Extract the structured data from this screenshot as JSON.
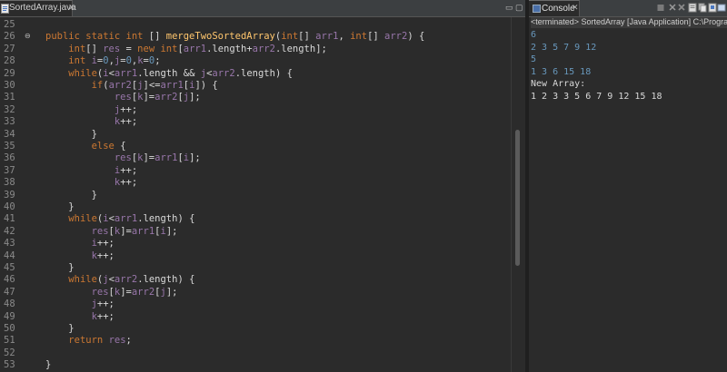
{
  "editor": {
    "tab_label": "SortedArray.java",
    "tab_close": "✕",
    "minimize": "▭",
    "maximize": "▢",
    "lines": [
      {
        "num": "25",
        "tokens": [
          {
            "t": "",
            "c": "pl"
          }
        ]
      },
      {
        "num": "26",
        "fold": true,
        "tokens": [
          {
            "t": "public static int ",
            "c": "kw"
          },
          {
            "t": "[] ",
            "c": "pl"
          },
          {
            "t": "mergeTwoSortedArray",
            "c": "mt"
          },
          {
            "t": "(",
            "c": "pl"
          },
          {
            "t": "int",
            "c": "kw"
          },
          {
            "t": "[] ",
            "c": "pl"
          },
          {
            "t": "arr1",
            "c": "vr"
          },
          {
            "t": ", ",
            "c": "pl"
          },
          {
            "t": "int",
            "c": "kw"
          },
          {
            "t": "[] ",
            "c": "pl"
          },
          {
            "t": "arr2",
            "c": "vr"
          },
          {
            "t": ") {",
            "c": "pl"
          }
        ]
      },
      {
        "num": "27",
        "tokens": [
          {
            "t": "    ",
            "c": "pl"
          },
          {
            "t": "int",
            "c": "kw"
          },
          {
            "t": "[] ",
            "c": "pl"
          },
          {
            "t": "res",
            "c": "vr"
          },
          {
            "t": " = ",
            "c": "pl"
          },
          {
            "t": "new int",
            "c": "kw"
          },
          {
            "t": "[",
            "c": "pl"
          },
          {
            "t": "arr1",
            "c": "vr"
          },
          {
            "t": ".length+",
            "c": "pl"
          },
          {
            "t": "arr2",
            "c": "vr"
          },
          {
            "t": ".length];",
            "c": "pl"
          }
        ]
      },
      {
        "num": "28",
        "tokens": [
          {
            "t": "    ",
            "c": "pl"
          },
          {
            "t": "int ",
            "c": "kw"
          },
          {
            "t": "i",
            "c": "vr"
          },
          {
            "t": "=",
            "c": "pl"
          },
          {
            "t": "0",
            "c": "nm"
          },
          {
            "t": ",",
            "c": "pl"
          },
          {
            "t": "j",
            "c": "vr"
          },
          {
            "t": "=",
            "c": "pl"
          },
          {
            "t": "0",
            "c": "nm"
          },
          {
            "t": ",",
            "c": "pl"
          },
          {
            "t": "k",
            "c": "vr"
          },
          {
            "t": "=",
            "c": "pl"
          },
          {
            "t": "0",
            "c": "nm"
          },
          {
            "t": ";",
            "c": "pl"
          }
        ]
      },
      {
        "num": "29",
        "tokens": [
          {
            "t": "    ",
            "c": "pl"
          },
          {
            "t": "while",
            "c": "kw"
          },
          {
            "t": "(",
            "c": "pl"
          },
          {
            "t": "i",
            "c": "vr"
          },
          {
            "t": "<",
            "c": "pl"
          },
          {
            "t": "arr1",
            "c": "vr"
          },
          {
            "t": ".length && ",
            "c": "pl"
          },
          {
            "t": "j",
            "c": "vr"
          },
          {
            "t": "<",
            "c": "pl"
          },
          {
            "t": "arr2",
            "c": "vr"
          },
          {
            "t": ".length) {",
            "c": "pl"
          }
        ]
      },
      {
        "num": "30",
        "tokens": [
          {
            "t": "        ",
            "c": "pl"
          },
          {
            "t": "if",
            "c": "kw"
          },
          {
            "t": "(",
            "c": "pl"
          },
          {
            "t": "arr2",
            "c": "vr"
          },
          {
            "t": "[",
            "c": "pl"
          },
          {
            "t": "j",
            "c": "vr"
          },
          {
            "t": "]<=",
            "c": "pl"
          },
          {
            "t": "arr1",
            "c": "vr"
          },
          {
            "t": "[",
            "c": "pl"
          },
          {
            "t": "i",
            "c": "vr"
          },
          {
            "t": "]) {",
            "c": "pl"
          }
        ]
      },
      {
        "num": "31",
        "tokens": [
          {
            "t": "            ",
            "c": "pl"
          },
          {
            "t": "res",
            "c": "vr"
          },
          {
            "t": "[",
            "c": "pl"
          },
          {
            "t": "k",
            "c": "vr"
          },
          {
            "t": "]=",
            "c": "pl"
          },
          {
            "t": "arr2",
            "c": "vr"
          },
          {
            "t": "[",
            "c": "pl"
          },
          {
            "t": "j",
            "c": "vr"
          },
          {
            "t": "];",
            "c": "pl"
          }
        ]
      },
      {
        "num": "32",
        "tokens": [
          {
            "t": "            ",
            "c": "pl"
          },
          {
            "t": "j",
            "c": "vr"
          },
          {
            "t": "++;",
            "c": "pl"
          }
        ]
      },
      {
        "num": "33",
        "tokens": [
          {
            "t": "            ",
            "c": "pl"
          },
          {
            "t": "k",
            "c": "vr"
          },
          {
            "t": "++;",
            "c": "pl"
          }
        ]
      },
      {
        "num": "34",
        "tokens": [
          {
            "t": "        }",
            "c": "pl"
          }
        ]
      },
      {
        "num": "35",
        "tokens": [
          {
            "t": "        ",
            "c": "pl"
          },
          {
            "t": "else",
            "c": "kw"
          },
          {
            "t": " {",
            "c": "pl"
          }
        ]
      },
      {
        "num": "36",
        "tokens": [
          {
            "t": "            ",
            "c": "pl"
          },
          {
            "t": "res",
            "c": "vr"
          },
          {
            "t": "[",
            "c": "pl"
          },
          {
            "t": "k",
            "c": "vr"
          },
          {
            "t": "]=",
            "c": "pl"
          },
          {
            "t": "arr1",
            "c": "vr"
          },
          {
            "t": "[",
            "c": "pl"
          },
          {
            "t": "i",
            "c": "vr"
          },
          {
            "t": "];",
            "c": "pl"
          }
        ]
      },
      {
        "num": "37",
        "tokens": [
          {
            "t": "            ",
            "c": "pl"
          },
          {
            "t": "i",
            "c": "vr"
          },
          {
            "t": "++;",
            "c": "pl"
          }
        ]
      },
      {
        "num": "38",
        "tokens": [
          {
            "t": "            ",
            "c": "pl"
          },
          {
            "t": "k",
            "c": "vr"
          },
          {
            "t": "++;",
            "c": "pl"
          }
        ]
      },
      {
        "num": "39",
        "tokens": [
          {
            "t": "        }",
            "c": "pl"
          }
        ]
      },
      {
        "num": "40",
        "tokens": [
          {
            "t": "    }",
            "c": "pl"
          }
        ]
      },
      {
        "num": "41",
        "tokens": [
          {
            "t": "    ",
            "c": "pl"
          },
          {
            "t": "while",
            "c": "kw"
          },
          {
            "t": "(",
            "c": "pl"
          },
          {
            "t": "i",
            "c": "vr"
          },
          {
            "t": "<",
            "c": "pl"
          },
          {
            "t": "arr1",
            "c": "vr"
          },
          {
            "t": ".length) {",
            "c": "pl"
          }
        ]
      },
      {
        "num": "42",
        "tokens": [
          {
            "t": "        ",
            "c": "pl"
          },
          {
            "t": "res",
            "c": "vr"
          },
          {
            "t": "[",
            "c": "pl"
          },
          {
            "t": "k",
            "c": "vr"
          },
          {
            "t": "]=",
            "c": "pl"
          },
          {
            "t": "arr1",
            "c": "vr"
          },
          {
            "t": "[",
            "c": "pl"
          },
          {
            "t": "i",
            "c": "vr"
          },
          {
            "t": "];",
            "c": "pl"
          }
        ]
      },
      {
        "num": "43",
        "tokens": [
          {
            "t": "        ",
            "c": "pl"
          },
          {
            "t": "i",
            "c": "vr"
          },
          {
            "t": "++;",
            "c": "pl"
          }
        ]
      },
      {
        "num": "44",
        "tokens": [
          {
            "t": "        ",
            "c": "pl"
          },
          {
            "t": "k",
            "c": "vr"
          },
          {
            "t": "++;",
            "c": "pl"
          }
        ]
      },
      {
        "num": "45",
        "tokens": [
          {
            "t": "    }",
            "c": "pl"
          }
        ]
      },
      {
        "num": "46",
        "tokens": [
          {
            "t": "    ",
            "c": "pl"
          },
          {
            "t": "while",
            "c": "kw"
          },
          {
            "t": "(",
            "c": "pl"
          },
          {
            "t": "j",
            "c": "vr"
          },
          {
            "t": "<",
            "c": "pl"
          },
          {
            "t": "arr2",
            "c": "vr"
          },
          {
            "t": ".length) {",
            "c": "pl"
          }
        ]
      },
      {
        "num": "47",
        "tokens": [
          {
            "t": "        ",
            "c": "pl"
          },
          {
            "t": "res",
            "c": "vr"
          },
          {
            "t": "[",
            "c": "pl"
          },
          {
            "t": "k",
            "c": "vr"
          },
          {
            "t": "]=",
            "c": "pl"
          },
          {
            "t": "arr2",
            "c": "vr"
          },
          {
            "t": "[",
            "c": "pl"
          },
          {
            "t": "j",
            "c": "vr"
          },
          {
            "t": "];",
            "c": "pl"
          }
        ]
      },
      {
        "num": "48",
        "tokens": [
          {
            "t": "        ",
            "c": "pl"
          },
          {
            "t": "j",
            "c": "vr"
          },
          {
            "t": "++;",
            "c": "pl"
          }
        ]
      },
      {
        "num": "49",
        "tokens": [
          {
            "t": "        ",
            "c": "pl"
          },
          {
            "t": "k",
            "c": "vr"
          },
          {
            "t": "++;",
            "c": "pl"
          }
        ]
      },
      {
        "num": "50",
        "tokens": [
          {
            "t": "    }",
            "c": "pl"
          }
        ]
      },
      {
        "num": "51",
        "tokens": [
          {
            "t": "    ",
            "c": "pl"
          },
          {
            "t": "return ",
            "c": "kw"
          },
          {
            "t": "res",
            "c": "vr"
          },
          {
            "t": ";",
            "c": "pl"
          }
        ]
      },
      {
        "num": "52",
        "tokens": [
          {
            "t": "",
            "c": "pl"
          }
        ]
      },
      {
        "num": "53",
        "tokens": [
          {
            "t": "}",
            "c": "pl"
          }
        ]
      }
    ]
  },
  "console": {
    "tab_label": "Console",
    "tab_close": "✕",
    "status_line": "<terminated> SortedArray [Java Application] C:\\Program",
    "output": [
      {
        "text": "6",
        "kind": "input"
      },
      {
        "text": "2 3 5 7 9 12",
        "kind": "input"
      },
      {
        "text": "5",
        "kind": "input"
      },
      {
        "text": "1 3 6 15 18",
        "kind": "input"
      },
      {
        "text": "New Array:",
        "kind": "plain"
      },
      {
        "text": "1 2 3 3 5 6 7 9 12 15 18",
        "kind": "plain"
      }
    ],
    "toolbar_icons": [
      "terminate-icon",
      "remove-launch-icon",
      "remove-all-icon",
      "scroll-lock-icon",
      "copy-icon",
      "pin-icon",
      "display-console-icon"
    ]
  },
  "colors": {
    "keyword": "#cc7832",
    "method": "#ffc66d",
    "variable": "#9876aa",
    "number": "#6897bb",
    "console_input": "#6897bb"
  }
}
